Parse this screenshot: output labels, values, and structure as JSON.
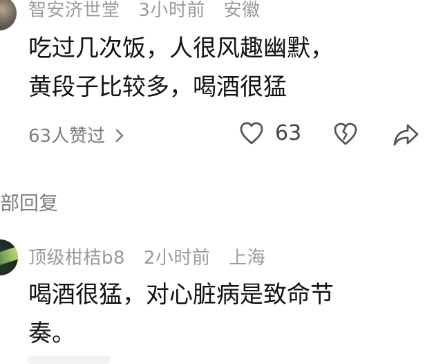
{
  "comments": [
    {
      "author": "智安济世堂",
      "time": "3小时前",
      "location": "安徽",
      "text_lines": [
        "吃过几次饭，人很风趣幽默，",
        "黄段子比较多，喝酒很猛"
      ],
      "liked_by_summary": "63人赞过",
      "like_count": "63",
      "avatar_icon": "avatar-image",
      "actions": [
        "heart-icon",
        "broken-heart-icon",
        "share-icon"
      ]
    },
    {
      "author": "顶级柑桔b8",
      "time": "2小时前",
      "location": "上海",
      "text_lines": [
        "喝酒很猛，对心脏病是致命节",
        "奏。"
      ],
      "avatar_icon": "avatar-image"
    }
  ],
  "replies_link_text": "部回复",
  "colors": {
    "meta_gray": "#9a9a9a",
    "text": "#111111",
    "icon_gray": "#7b7b7b",
    "background": "#ffffff"
  }
}
